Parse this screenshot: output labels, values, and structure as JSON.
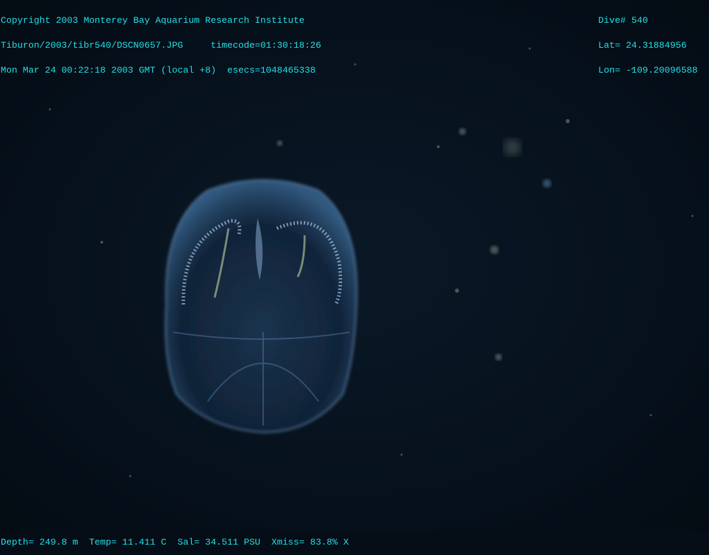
{
  "overlay": {
    "top_left": {
      "copyright": "Copyright 2003 Monterey Bay Aquarium Research Institute",
      "file_line": "Tiburon/2003/tibr540/DSCN0657.JPG     timecode=01:30:18:26",
      "date_line": "Mon Mar 24 00:22:18 2003 GMT (local +8)  esecs=1048465338"
    },
    "top_right": {
      "dive": "Dive# 540",
      "lat": "Lat= 24.31884956",
      "lon": "Lon= -109.20096588"
    },
    "bottom": {
      "sensors": "Depth= 249.8 m  Temp= 11.411 C  Sal= 34.511 PSU  Xmiss= 83.8% X"
    }
  },
  "colors": {
    "overlay_text": "#22e0e6",
    "background": "#06111c",
    "organism": "#6fa8d8"
  }
}
